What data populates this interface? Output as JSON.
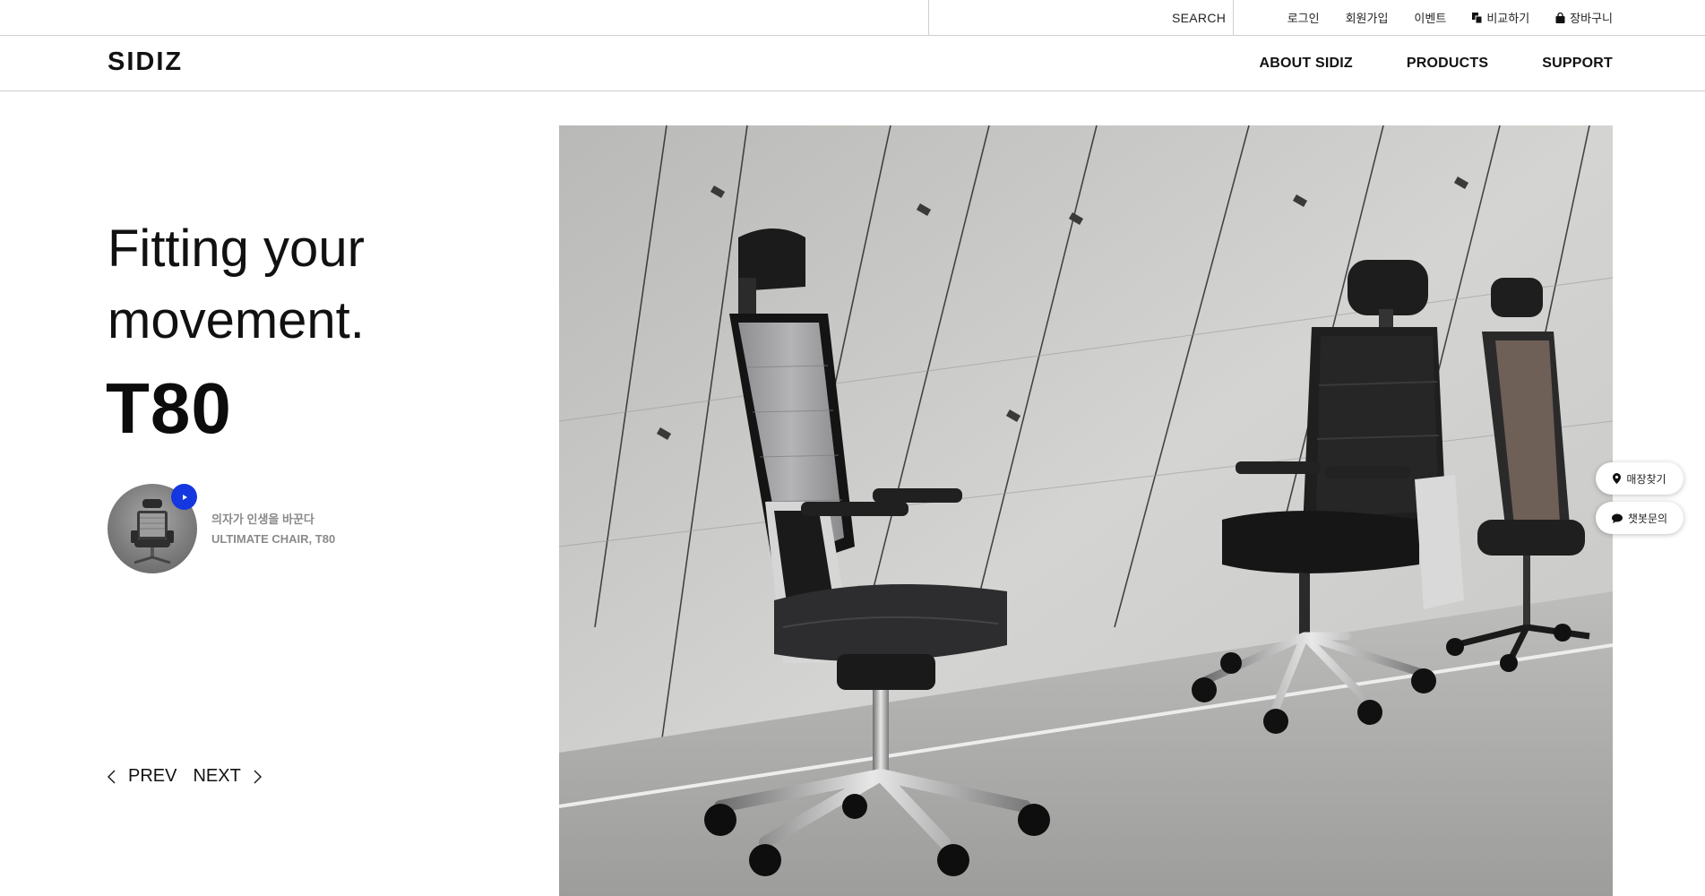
{
  "utility_bar": {
    "search_label": "SEARCH",
    "links": {
      "login": "로그인",
      "signup": "회원가입",
      "event": "이벤트",
      "compare": "비교하기",
      "cart": "장바구니"
    },
    "icons": {
      "compare": "compare-icon",
      "cart": "shopping-bag-icon"
    }
  },
  "main_nav": {
    "logo": "SIDIZ",
    "items": [
      "ABOUT SIDIZ",
      "PRODUCTS",
      "SUPPORT"
    ]
  },
  "hero": {
    "headline_line1": "Fitting your",
    "headline_line2": "movement.",
    "model": "T80",
    "video": {
      "caption_kr": "의자가 인생을 바꾼다",
      "caption_en": "ULTIMATE CHAIR, T80",
      "play_icon": "play-icon"
    },
    "controls": {
      "prev": "PREV",
      "next": "NEXT"
    }
  },
  "floating_buttons": {
    "store_finder": "매장찾기",
    "chatbot": "챗봇문의",
    "icons": {
      "store_finder": "map-pin-icon",
      "chatbot": "chat-bubble-icon"
    }
  },
  "colors": {
    "accent_blue": "#1437e0",
    "text": "#111111",
    "border": "#cfcfcf",
    "caption_gray": "#8a8a8a"
  }
}
